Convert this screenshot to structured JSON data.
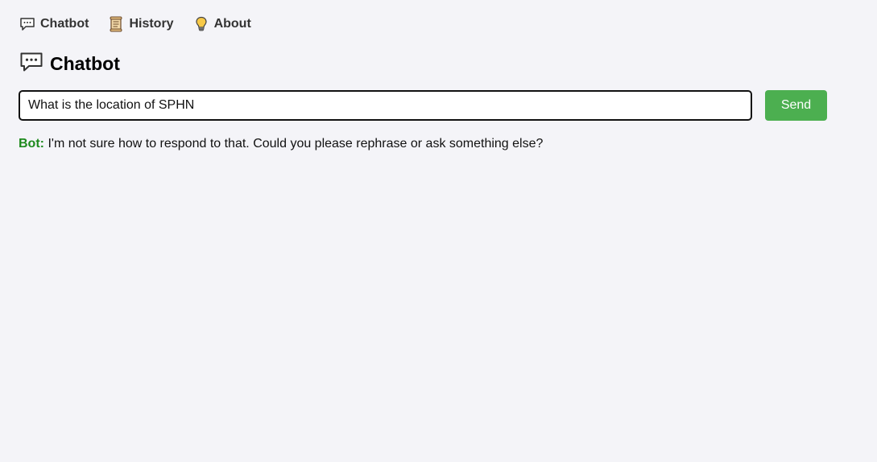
{
  "nav": {
    "items": [
      {
        "label": "Chatbot",
        "icon": "speech-bubble-icon"
      },
      {
        "label": "History",
        "icon": "scroll-icon"
      },
      {
        "label": "About",
        "icon": "lightbulb-icon"
      }
    ]
  },
  "header": {
    "title": "Chatbot",
    "icon": "speech-bubble-icon"
  },
  "chat": {
    "input_value": "What is the location of SPHN",
    "send_label": "Send",
    "messages": [
      {
        "sender": "Bot:",
        "text": "I'm not sure how to respond to that. Could you please rephrase or ask something else?"
      }
    ]
  },
  "colors": {
    "background": "#f4f4f8",
    "send_button": "#4caf50",
    "bot_label": "#1e8a1e"
  }
}
